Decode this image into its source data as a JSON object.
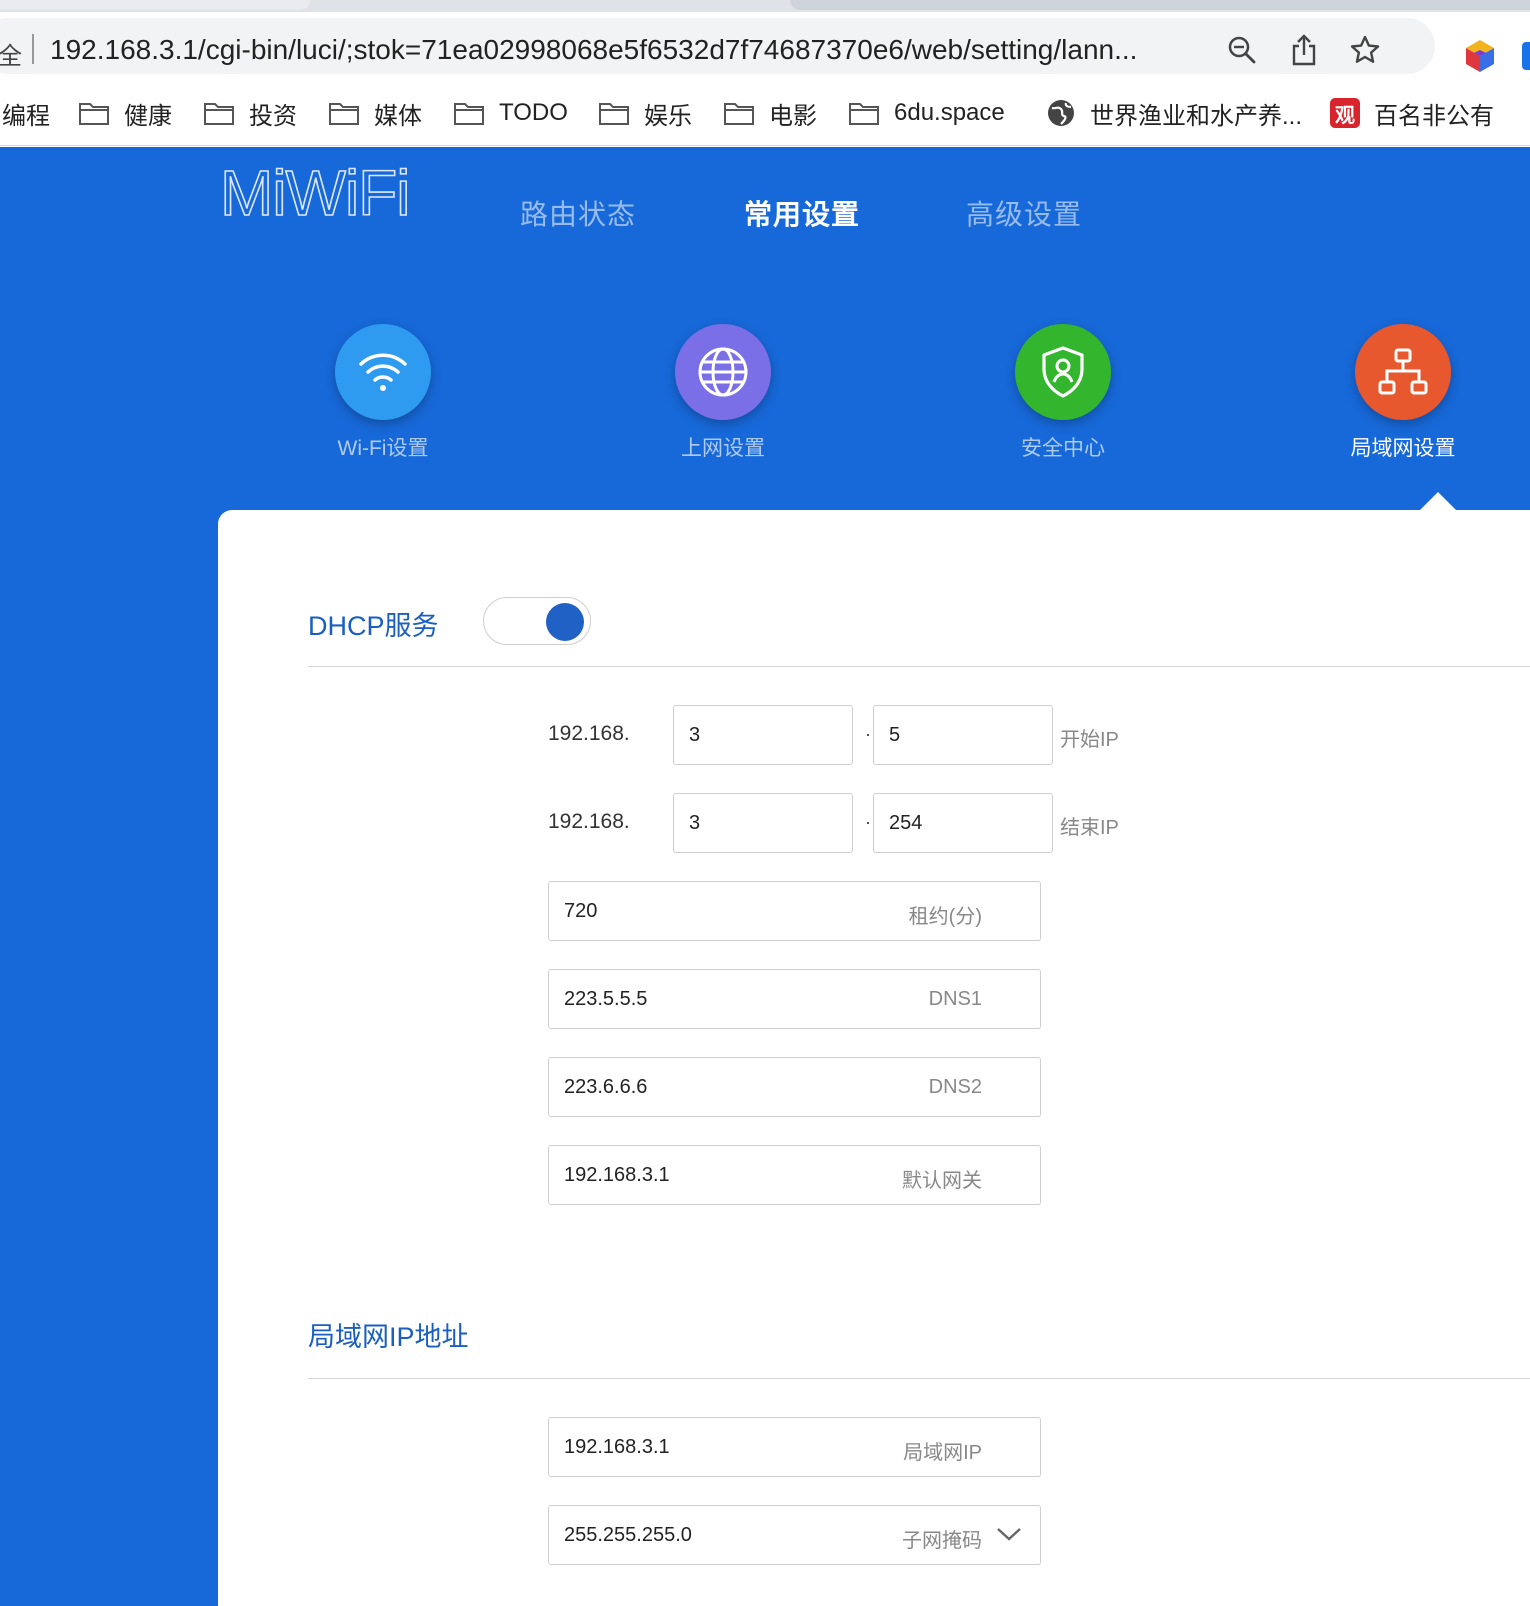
{
  "browser": {
    "omnibox_prefix": "全",
    "url": "192.168.3.1/cgi-bin/luci/;stok=71ea02998068e5f6532d7f74687370e6/web/setting/lann...",
    "bookmarks": [
      {
        "label": "编程",
        "icon": "none"
      },
      {
        "label": "健康",
        "icon": "folder-icon"
      },
      {
        "label": "投资",
        "icon": "folder-icon"
      },
      {
        "label": "媒体",
        "icon": "folder-icon"
      },
      {
        "label": "TODO",
        "icon": "folder-icon"
      },
      {
        "label": "娱乐",
        "icon": "folder-icon"
      },
      {
        "label": "电影",
        "icon": "folder-icon"
      },
      {
        "label": "6du.space",
        "icon": "folder-icon"
      },
      {
        "label": "世界渔业和水产养...",
        "icon": "globe-icon"
      },
      {
        "label": "百名非公有",
        "icon": "guan-icon",
        "icon_text": "观"
      }
    ]
  },
  "app": {
    "logo": "MiWiFi",
    "nav": [
      {
        "label": "路由状态",
        "active": false
      },
      {
        "label": "常用设置",
        "active": true
      },
      {
        "label": "高级设置",
        "active": false
      }
    ],
    "categories": [
      {
        "label": "Wi-Fi设置",
        "icon": "wifi-icon",
        "color": "#2e9bf0",
        "active": false
      },
      {
        "label": "上网设置",
        "icon": "globe-icon",
        "color": "#7b6fe8",
        "active": false
      },
      {
        "label": "安全中心",
        "icon": "shield-icon",
        "color": "#33b52d",
        "active": false
      },
      {
        "label": "局域网设置",
        "icon": "network-icon",
        "color": "#e8582e",
        "active": true
      }
    ]
  },
  "dhcp": {
    "title": "DHCP服务",
    "enabled": true,
    "start": {
      "prefix": "192.168.",
      "octet3": "3",
      "octet4": "5",
      "label": "开始IP"
    },
    "end": {
      "prefix": "192.168.",
      "octet3": "3",
      "octet4": "254",
      "label": "结束IP"
    },
    "dot": "·",
    "lease": {
      "value": "720",
      "hint": "租约(分)"
    },
    "dns1": {
      "value": "223.5.5.5",
      "hint": "DNS1"
    },
    "dns2": {
      "value": "223.6.6.6",
      "hint": "DNS2"
    },
    "gateway": {
      "value": "192.168.3.1",
      "hint": "默认网关"
    }
  },
  "lan": {
    "title": "局域网IP地址",
    "ip": {
      "value": "192.168.3.1",
      "hint": "局域网IP"
    },
    "mask": {
      "value": "255.255.255.0",
      "hint": "子网掩码"
    }
  }
}
